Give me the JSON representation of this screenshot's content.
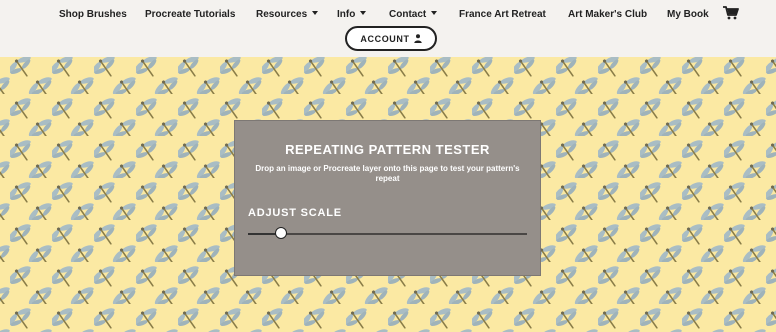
{
  "nav": {
    "items": [
      {
        "label": "Shop Brushes",
        "dropdown": false
      },
      {
        "label": "Procreate Tutorials",
        "dropdown": false
      },
      {
        "label": "Resources",
        "dropdown": true
      },
      {
        "label": "Info",
        "dropdown": true
      },
      {
        "label": "Contact",
        "dropdown": true
      },
      {
        "label": "France Art Retreat",
        "dropdown": false
      },
      {
        "label": "Art Maker's Club",
        "dropdown": false
      },
      {
        "label": "My Book",
        "dropdown": false
      }
    ],
    "cart_icon": "shopping-cart-icon",
    "account_label": "ACCOUNT",
    "account_icon": "user-icon"
  },
  "pattern": {
    "motif": "dragonfly-icon",
    "background_color": "#fbe9a3"
  },
  "panel": {
    "title": "REPEATING PATTERN TESTER",
    "description": "Drop an image or Procreate layer onto this page to test your pattern's repeat",
    "scale_label": "ADJUST SCALE",
    "scale_value": 0.12,
    "background_color": "#958f8a"
  }
}
